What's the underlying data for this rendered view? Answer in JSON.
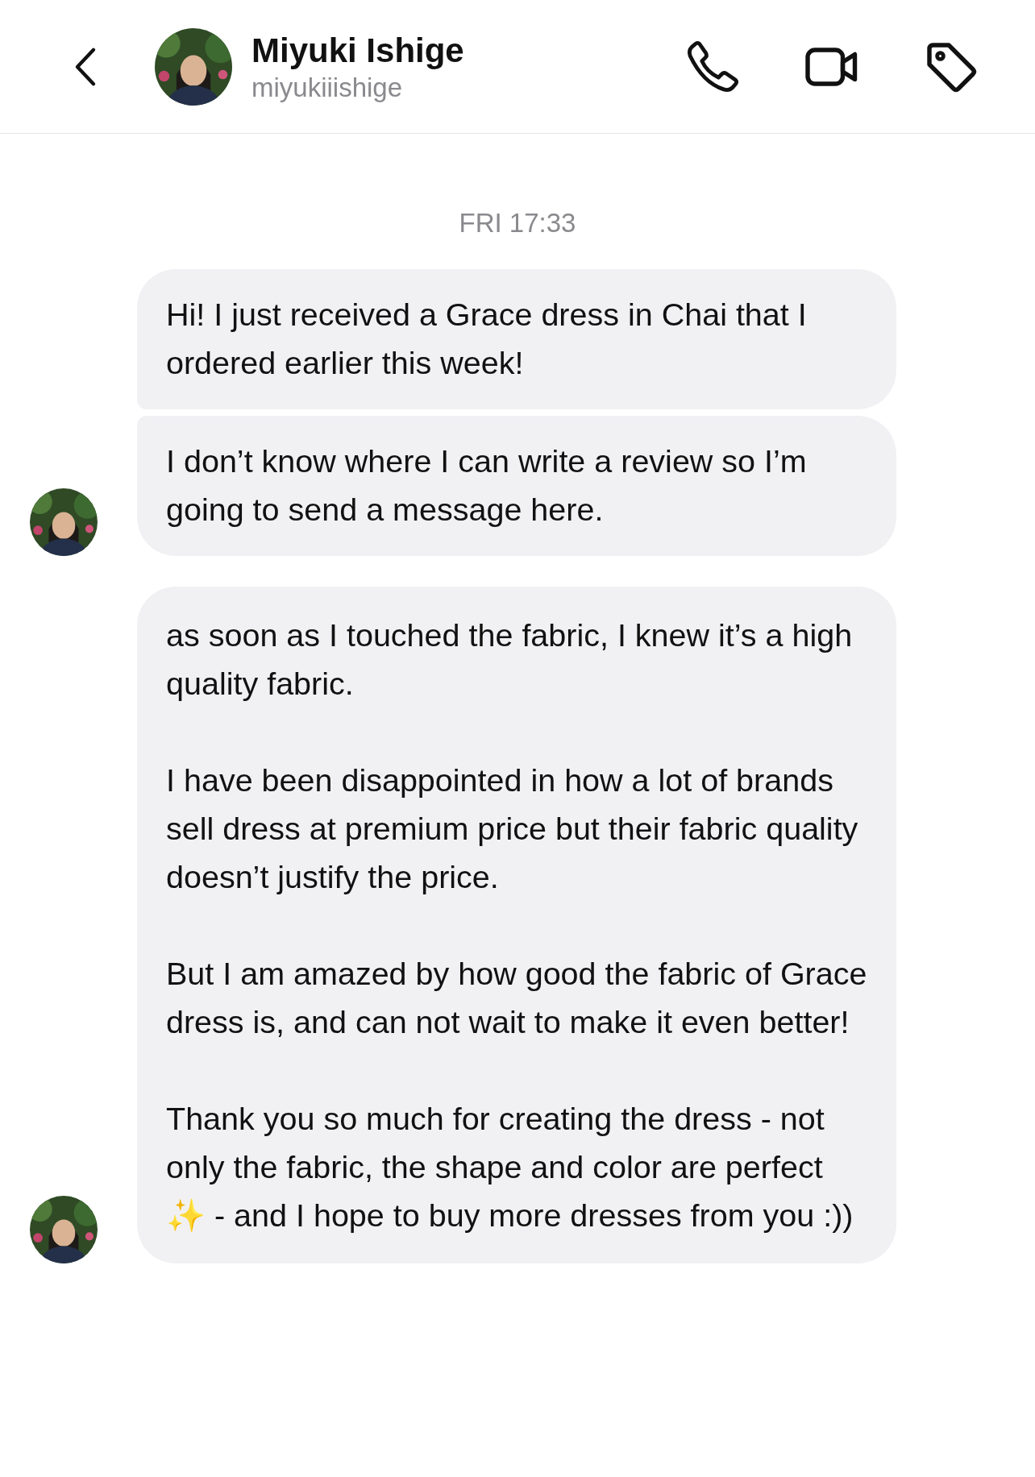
{
  "header": {
    "name": "Miyuki Ishige",
    "username": "miyukiiishige"
  },
  "timestamp": "FRI 17:33",
  "groups": [
    {
      "messages": [
        {
          "paragraphs": [
            "Hi! I just received a Grace dress in Chai that I ordered earlier this week!"
          ]
        },
        {
          "paragraphs": [
            "I don’t know where I can write a review so I’m going to send a message here."
          ]
        }
      ]
    },
    {
      "messages": [
        {
          "paragraphs": [
            "as soon as I touched the fabric, I knew it’s a high quality fabric.",
            "I have been disappointed in how a lot of brands sell dress at premium price but their fabric quality doesn’t justify the price.",
            "But I am amazed by how good the fabric of Grace dress is, and can not wait to make it even better!",
            "Thank you so much for creating the dress - not only the fabric, the shape and color are perfect ✨ - and I hope to buy more dresses from you :))"
          ]
        }
      ]
    }
  ]
}
